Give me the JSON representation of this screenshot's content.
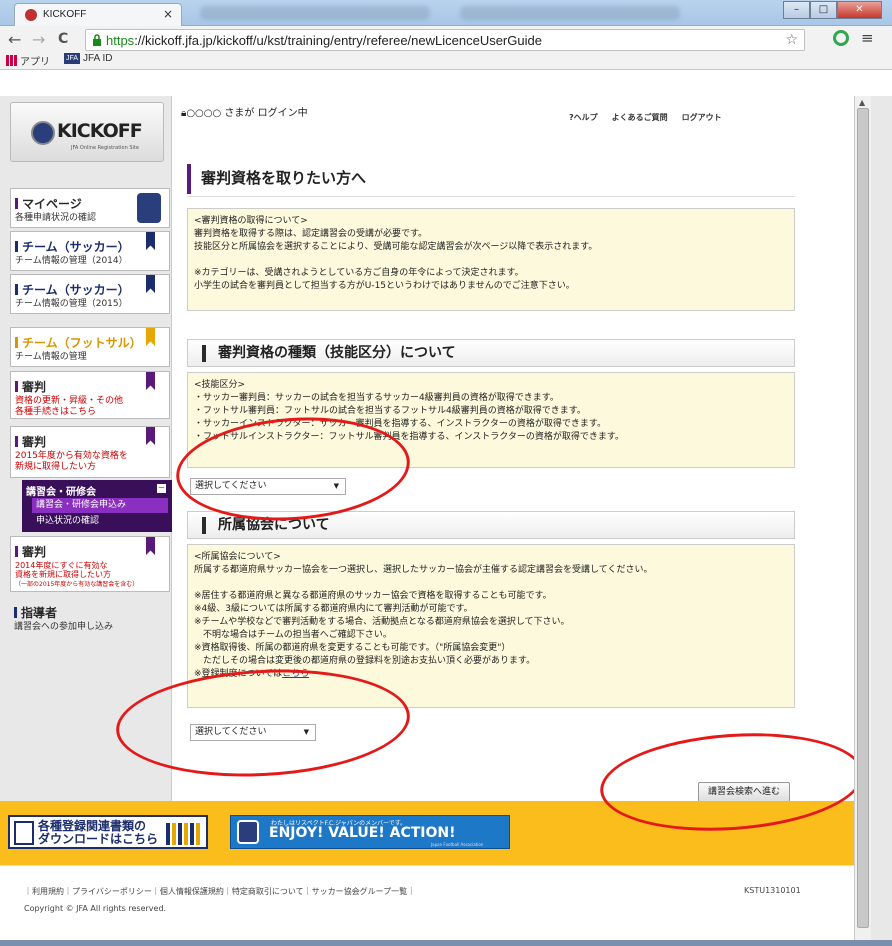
{
  "browser": {
    "tab_title": "KICKOFF",
    "tab_close": "×",
    "url_https": "https",
    "url_rest": "://kickoff.jfa.jp/kickoff/u/kst/training/entry/referee/newLicenceUserGuide",
    "bookmarks": [
      {
        "label": "アプリ"
      },
      {
        "label": "JFA ID"
      }
    ],
    "win_min": "–",
    "win_max": "□",
    "win_close": "✕",
    "nav_back": "←",
    "nav_forward": "→",
    "nav_reload": "C",
    "jfa_badge": "JFA"
  },
  "header": {
    "login_status": "○○○○ さまが ログイン中",
    "links": [
      "?ヘルプ",
      "よくあるご質問",
      "ログアウト"
    ]
  },
  "logo": {
    "text": "KICKOFF",
    "sub": "JFA Online Registration Site"
  },
  "sidebar": {
    "items": [
      {
        "title": "マイページ",
        "sub": "各種申請状況の確認"
      },
      {
        "title": "チーム（サッカー）",
        "sub": "チーム情報の管理（2014）"
      },
      {
        "title": "チーム（サッカー）",
        "sub": "チーム情報の管理（2015）"
      },
      {
        "title": "チーム（フットサル）",
        "sub": "チーム情報の管理"
      },
      {
        "title": "審判",
        "sub1": "資格の更新・昇級・その他",
        "sub2": "各種手続きはこちら"
      },
      {
        "title": "審判",
        "sub1": "2015年度から有効な資格を",
        "sub2": "新規に取得したい方"
      },
      {
        "title": "審判",
        "sub1": "2014年度にすぐに有効な",
        "sub2": "資格を新規に取得したい方",
        "sub3": "（一部の2015年度から有効な講習会を含む）"
      },
      {
        "title": "指導者",
        "sub": "講習会への参加申し込み"
      }
    ],
    "submenu": {
      "head": "講習会・研修会",
      "toggle": "－",
      "links": [
        "講習会・研修会申込み",
        "申込状況の確認"
      ]
    }
  },
  "main": {
    "title": "審判資格を取りたい方へ",
    "acquire_box": [
      "<審判資格の取得について>",
      "審判資格を取得する際は、認定講習会の受講が必要です。",
      "技能区分と所属協会を選択することにより、受講可能な認定講習会が次ページ以降で表示されます。",
      "",
      "※カテゴリーは、受講されようとしている方ご自身の年令によって決定されます。",
      "小学生の試合を審判員として担当する方がU-15というわけではありませんのでご注意下さい。"
    ],
    "section1_title": "審判資格の種類（技能区分）について",
    "skill_box": [
      "<技能区分>",
      "・サッカー審判員：サッカーの試合を担当するサッカー4級審判員の資格が取得できます。",
      "・フットサル審判員：フットサルの試合を担当するフットサル4級審判員の資格が取得できます。",
      "・サッカーインストラクター：サッカー審判員を指導する、インストラクターの資格が取得できます。",
      "・フットサルインストラクター：フットサル審判員を指導する、インストラクターの資格が取得できます。"
    ],
    "select1": "選択してください",
    "section2_title": "所属協会について",
    "assoc_box": [
      "<所属協会について>",
      "所属する都道府県サッカー協会を一つ選択し、選択したサッカー協会が主催する認定講習会を受講してください。",
      "",
      "※居住する都道府県と異なる都道府県のサッカー協会で資格を取得することも可能です。",
      "※4級、3級については所属する都道府県内にて審判活動が可能です。",
      "※チームや学校などで審判活動をする場合、活動拠点となる都道府県協会を選択して下さい。",
      "　不明な場合はチームの担当者へご確認下さい。",
      "※資格取得後、所属の都道府県を変更することも可能です。（\"所属協会変更\"）",
      "　ただしその場合は変更後の都道府県の登録料を別途お支払い頂く必要があります。"
    ],
    "assoc_link_prefix": "※登録制度については",
    "assoc_link": "こちら",
    "select2": "選択してください",
    "next_button": "講習会検索へ進む"
  },
  "footer": {
    "download_banner": [
      "各種登録関連書類の",
      "ダウンロードはこちら"
    ],
    "enjoy_small": "わたしはリスペクトF.C.ジャパンのメンバーです。",
    "enjoy_main": "ENJOY! VALUE! ACTION!",
    "enjoy_foot": "Japan Football Association",
    "links": "｜利用規約｜プライバシーポリシー｜個人情報保護規約｜特定商取引について｜サッカー協会グループ一覧｜",
    "code": "KSTU1310101",
    "copyright": "Copyright © JFA All rights reserved."
  },
  "colors": {
    "accent_navy": "#1c2d6e",
    "accent_purple": "#5a1a7a",
    "annotation_red": "#e41a1a",
    "footer_yellow": "#fbbd1c"
  }
}
